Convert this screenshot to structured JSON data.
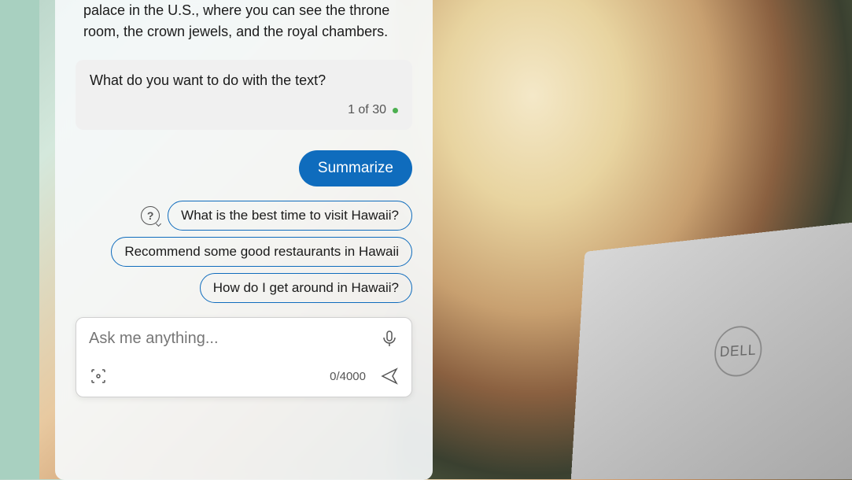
{
  "chat": {
    "assistant_msg": "palace in the U.S., where you can see the throne room, the crown jewels, and the royal chambers.",
    "prompt_card": {
      "text": "What do you want to do with the text?",
      "counter": "1 of 30"
    },
    "user_msg": "Summarize",
    "suggestions": [
      "What is the best time to visit Hawaii?",
      "Recommend some good restaurants in Hawaii",
      "How do I get around in Hawaii?"
    ]
  },
  "input": {
    "placeholder": "Ask me anything...",
    "counter": "0/4000"
  },
  "icons": {
    "help": "help-icon",
    "mic": "mic-icon",
    "scan": "scan-icon",
    "send": "send-icon"
  }
}
